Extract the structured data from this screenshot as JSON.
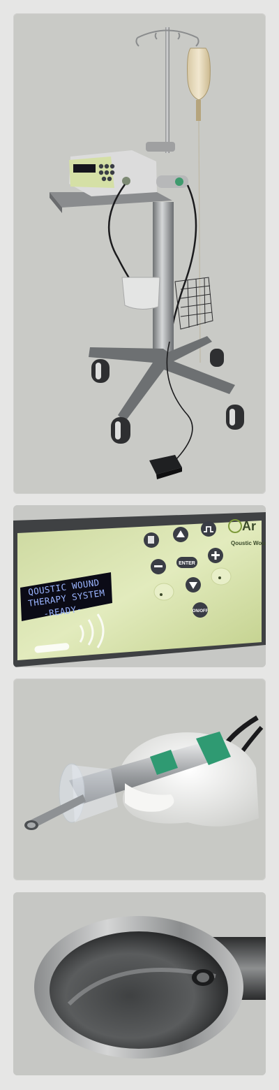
{
  "panels": [
    {
      "name": "cart-photo"
    },
    {
      "name": "control-panel-photo"
    },
    {
      "name": "handpiece-photo"
    },
    {
      "name": "tip-closeup-photo"
    }
  ],
  "display": {
    "line1": "QOUSTIC  WOUND",
    "line2": "THERAPY SYSTEM",
    "line3": "-READY-"
  },
  "control_panel": {
    "enter_key": "ENTER",
    "power_key": "ON/OFF",
    "brand_partial": "Ar",
    "brand_sub": "Qoustic Wound"
  },
  "colors": {
    "panel_bg": "#c9cac6",
    "device_green": "#d8e3a8",
    "lcd_bg": "#0b0b16",
    "lcd_text": "#9ab4ff",
    "button_dark": "#3a3d45",
    "glove": "#f2f2f0",
    "collar_green": "#2f9a72"
  }
}
